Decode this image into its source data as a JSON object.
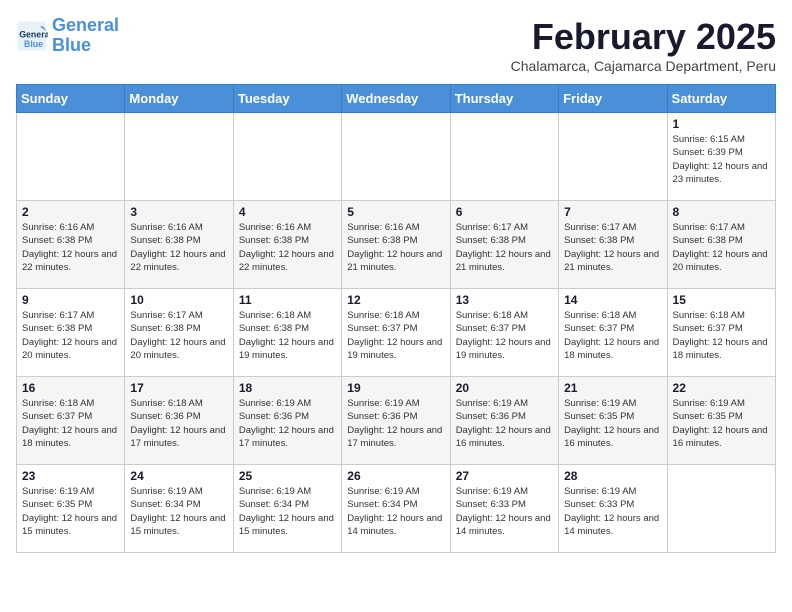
{
  "logo": {
    "line1": "General",
    "line2": "Blue"
  },
  "title": "February 2025",
  "location": "Chalamarca, Cajamarca Department, Peru",
  "days_of_week": [
    "Sunday",
    "Monday",
    "Tuesday",
    "Wednesday",
    "Thursday",
    "Friday",
    "Saturday"
  ],
  "weeks": [
    [
      {
        "day": "",
        "info": ""
      },
      {
        "day": "",
        "info": ""
      },
      {
        "day": "",
        "info": ""
      },
      {
        "day": "",
        "info": ""
      },
      {
        "day": "",
        "info": ""
      },
      {
        "day": "",
        "info": ""
      },
      {
        "day": "1",
        "info": "Sunrise: 6:15 AM\nSunset: 6:39 PM\nDaylight: 12 hours and 23 minutes."
      }
    ],
    [
      {
        "day": "2",
        "info": "Sunrise: 6:16 AM\nSunset: 6:38 PM\nDaylight: 12 hours and 22 minutes."
      },
      {
        "day": "3",
        "info": "Sunrise: 6:16 AM\nSunset: 6:38 PM\nDaylight: 12 hours and 22 minutes."
      },
      {
        "day": "4",
        "info": "Sunrise: 6:16 AM\nSunset: 6:38 PM\nDaylight: 12 hours and 22 minutes."
      },
      {
        "day": "5",
        "info": "Sunrise: 6:16 AM\nSunset: 6:38 PM\nDaylight: 12 hours and 21 minutes."
      },
      {
        "day": "6",
        "info": "Sunrise: 6:17 AM\nSunset: 6:38 PM\nDaylight: 12 hours and 21 minutes."
      },
      {
        "day": "7",
        "info": "Sunrise: 6:17 AM\nSunset: 6:38 PM\nDaylight: 12 hours and 21 minutes."
      },
      {
        "day": "8",
        "info": "Sunrise: 6:17 AM\nSunset: 6:38 PM\nDaylight: 12 hours and 20 minutes."
      }
    ],
    [
      {
        "day": "9",
        "info": "Sunrise: 6:17 AM\nSunset: 6:38 PM\nDaylight: 12 hours and 20 minutes."
      },
      {
        "day": "10",
        "info": "Sunrise: 6:17 AM\nSunset: 6:38 PM\nDaylight: 12 hours and 20 minutes."
      },
      {
        "day": "11",
        "info": "Sunrise: 6:18 AM\nSunset: 6:38 PM\nDaylight: 12 hours and 19 minutes."
      },
      {
        "day": "12",
        "info": "Sunrise: 6:18 AM\nSunset: 6:37 PM\nDaylight: 12 hours and 19 minutes."
      },
      {
        "day": "13",
        "info": "Sunrise: 6:18 AM\nSunset: 6:37 PM\nDaylight: 12 hours and 19 minutes."
      },
      {
        "day": "14",
        "info": "Sunrise: 6:18 AM\nSunset: 6:37 PM\nDaylight: 12 hours and 18 minutes."
      },
      {
        "day": "15",
        "info": "Sunrise: 6:18 AM\nSunset: 6:37 PM\nDaylight: 12 hours and 18 minutes."
      }
    ],
    [
      {
        "day": "16",
        "info": "Sunrise: 6:18 AM\nSunset: 6:37 PM\nDaylight: 12 hours and 18 minutes."
      },
      {
        "day": "17",
        "info": "Sunrise: 6:18 AM\nSunset: 6:36 PM\nDaylight: 12 hours and 17 minutes."
      },
      {
        "day": "18",
        "info": "Sunrise: 6:19 AM\nSunset: 6:36 PM\nDaylight: 12 hours and 17 minutes."
      },
      {
        "day": "19",
        "info": "Sunrise: 6:19 AM\nSunset: 6:36 PM\nDaylight: 12 hours and 17 minutes."
      },
      {
        "day": "20",
        "info": "Sunrise: 6:19 AM\nSunset: 6:36 PM\nDaylight: 12 hours and 16 minutes."
      },
      {
        "day": "21",
        "info": "Sunrise: 6:19 AM\nSunset: 6:35 PM\nDaylight: 12 hours and 16 minutes."
      },
      {
        "day": "22",
        "info": "Sunrise: 6:19 AM\nSunset: 6:35 PM\nDaylight: 12 hours and 16 minutes."
      }
    ],
    [
      {
        "day": "23",
        "info": "Sunrise: 6:19 AM\nSunset: 6:35 PM\nDaylight: 12 hours and 15 minutes."
      },
      {
        "day": "24",
        "info": "Sunrise: 6:19 AM\nSunset: 6:34 PM\nDaylight: 12 hours and 15 minutes."
      },
      {
        "day": "25",
        "info": "Sunrise: 6:19 AM\nSunset: 6:34 PM\nDaylight: 12 hours and 15 minutes."
      },
      {
        "day": "26",
        "info": "Sunrise: 6:19 AM\nSunset: 6:34 PM\nDaylight: 12 hours and 14 minutes."
      },
      {
        "day": "27",
        "info": "Sunrise: 6:19 AM\nSunset: 6:33 PM\nDaylight: 12 hours and 14 minutes."
      },
      {
        "day": "28",
        "info": "Sunrise: 6:19 AM\nSunset: 6:33 PM\nDaylight: 12 hours and 14 minutes."
      },
      {
        "day": "",
        "info": ""
      }
    ]
  ]
}
